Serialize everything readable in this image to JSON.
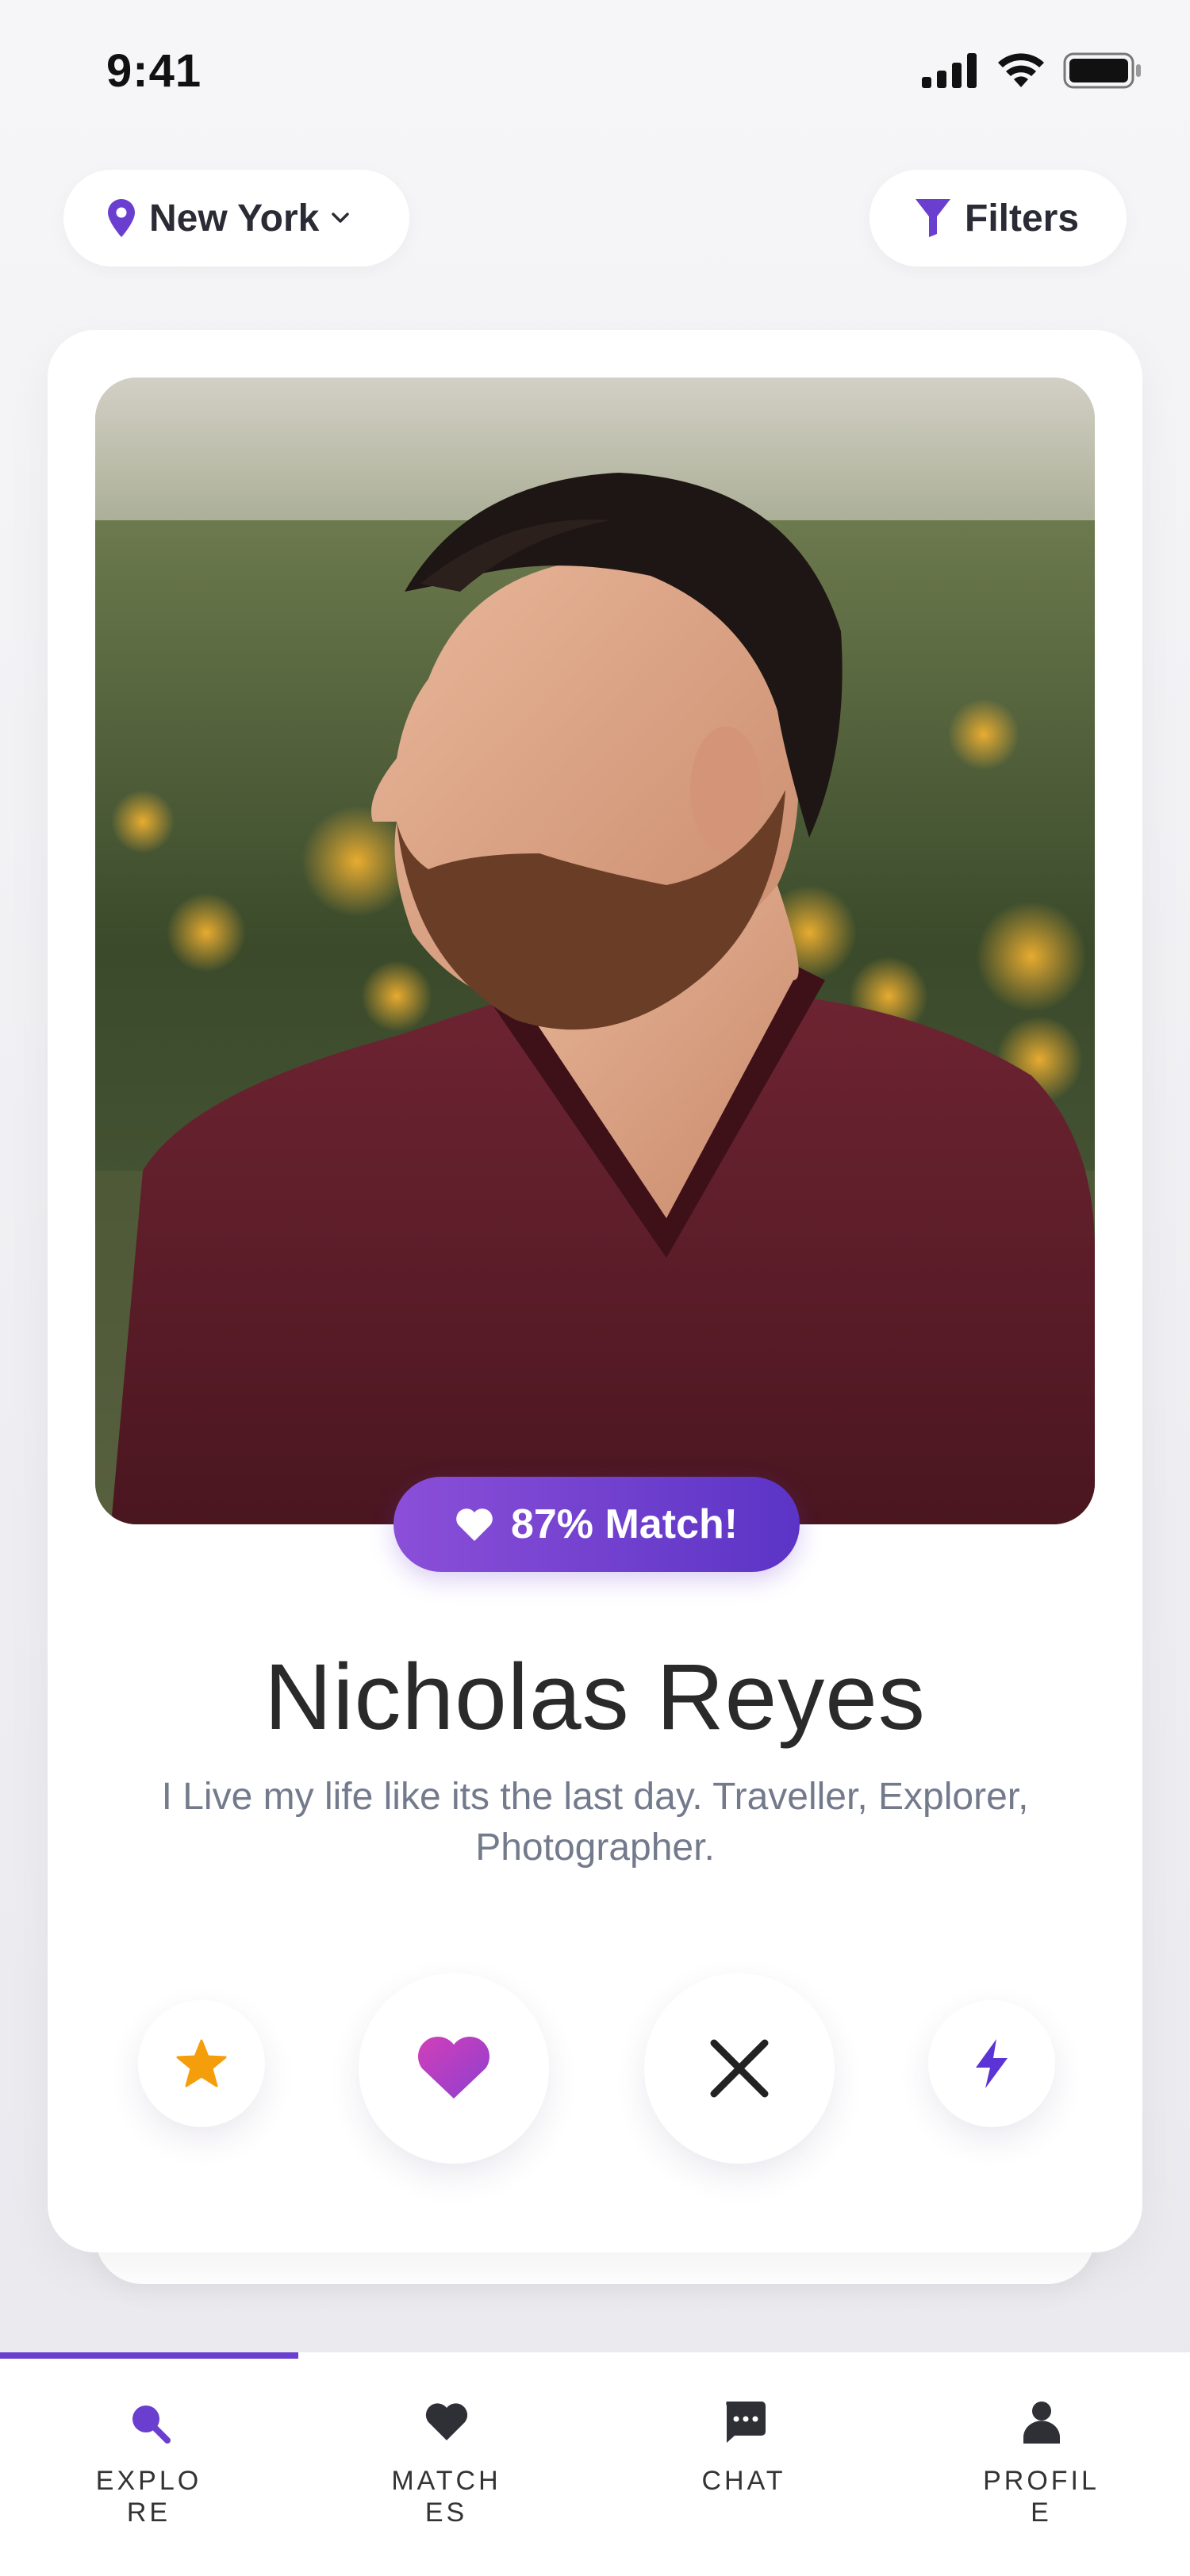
{
  "status_bar": {
    "time": "9:41"
  },
  "header": {
    "location": {
      "label": "New York",
      "icon": "map-pin-icon"
    },
    "filters": {
      "label": "Filters",
      "icon": "funnel-icon"
    }
  },
  "profile_card": {
    "photo": "portrait-photo",
    "match_label": "87% Match!",
    "name": "Nicholas Reyes",
    "bio": "I Live my life like its the last day. Traveller, Explorer, Photographer."
  },
  "actions": [
    {
      "name": "super-like",
      "icon": "star-icon",
      "color": "#f59e0b"
    },
    {
      "name": "like",
      "icon": "heart-icon",
      "color": "#b23fc8"
    },
    {
      "name": "nope",
      "icon": "close-icon",
      "color": "#222222"
    },
    {
      "name": "boost",
      "icon": "bolt-icon",
      "color": "#5b34d6"
    }
  ],
  "tabs": [
    {
      "label": "EXPLORE",
      "icon": "search-icon",
      "active": true
    },
    {
      "label": "MATCHES",
      "icon": "heart-icon",
      "active": false
    },
    {
      "label": "CHAT",
      "icon": "chat-bubble-icon",
      "active": false
    },
    {
      "label": "PROFILE",
      "icon": "user-icon",
      "active": false
    }
  ],
  "colors": {
    "accent": "#6a3fd0",
    "badge_start": "#8b4fd8",
    "badge_end": "#5b34c6"
  }
}
